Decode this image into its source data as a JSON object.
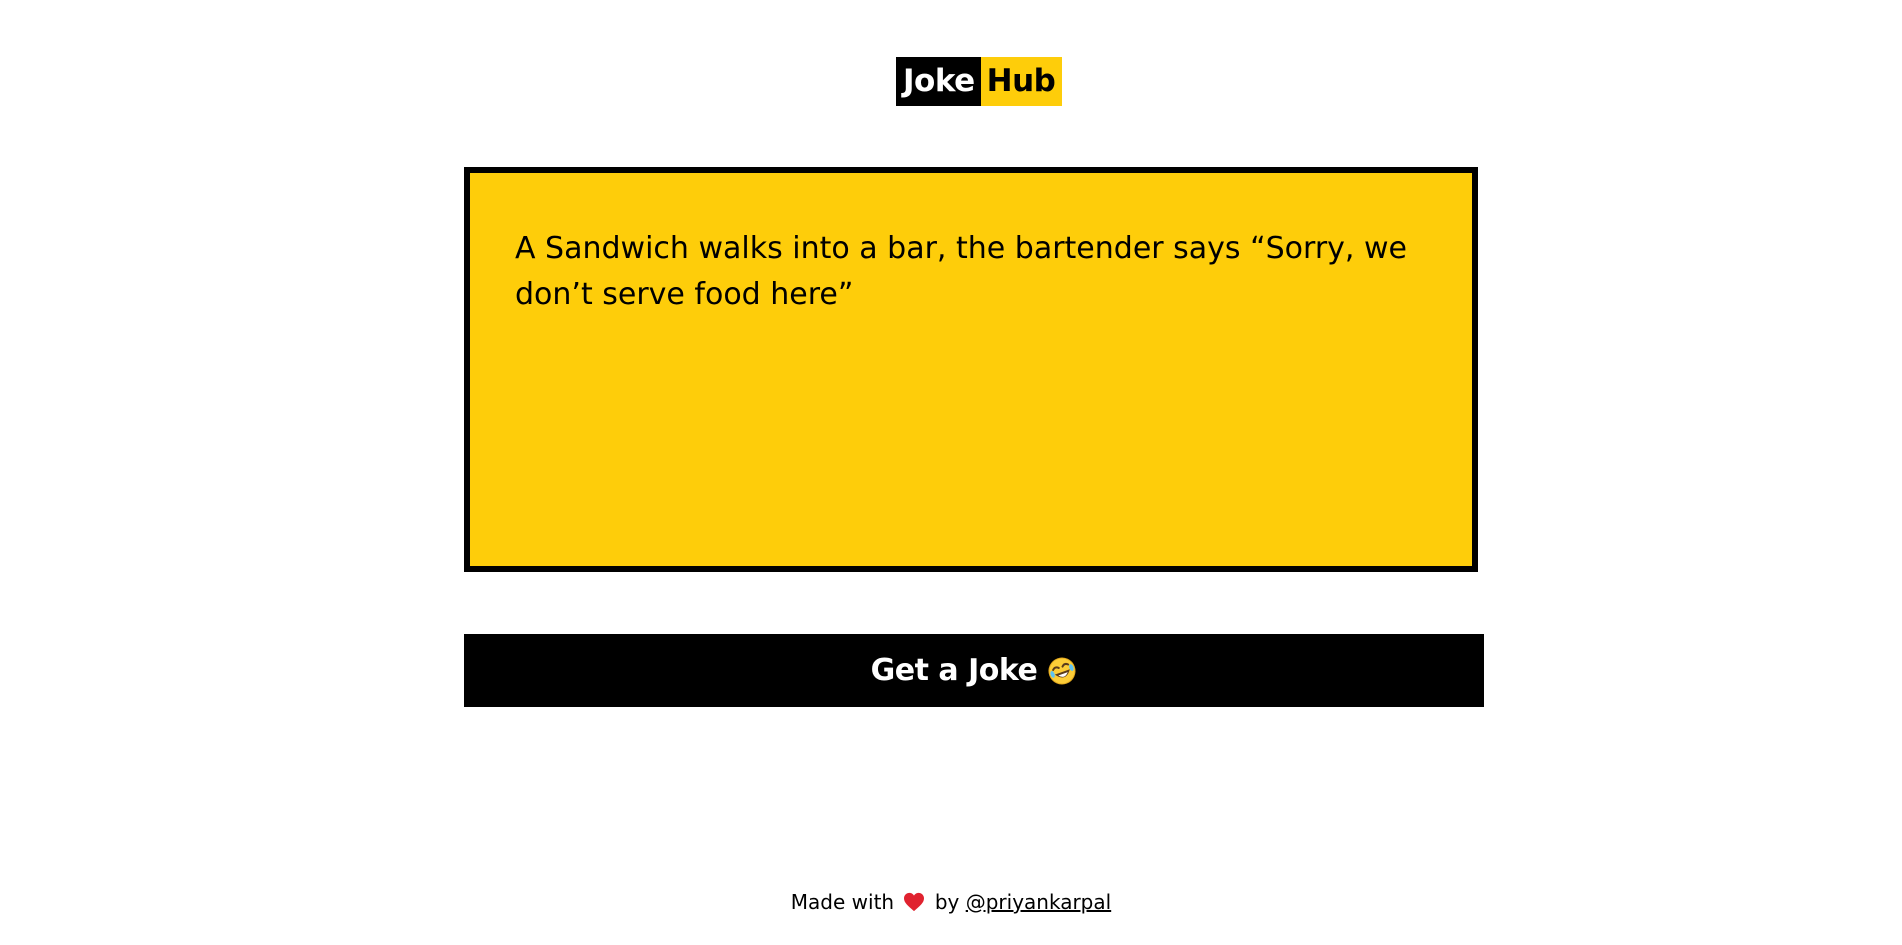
{
  "logo": {
    "part_a": "Joke",
    "part_b": "Hub"
  },
  "joke": {
    "text": "A Sandwich walks into a bar, the bartender says “Sorry, we don’t serve food here”"
  },
  "button": {
    "label": "Get a Joke",
    "icon": "rolling-on-floor-laughing-emoji"
  },
  "footer": {
    "prefix": "Made with",
    "heart_icon": "heart-icon",
    "middle": "by",
    "link_text": "@priyankarpal"
  },
  "colors": {
    "accent": "#fecd0a",
    "dark": "#000000",
    "background": "#ffffff"
  }
}
